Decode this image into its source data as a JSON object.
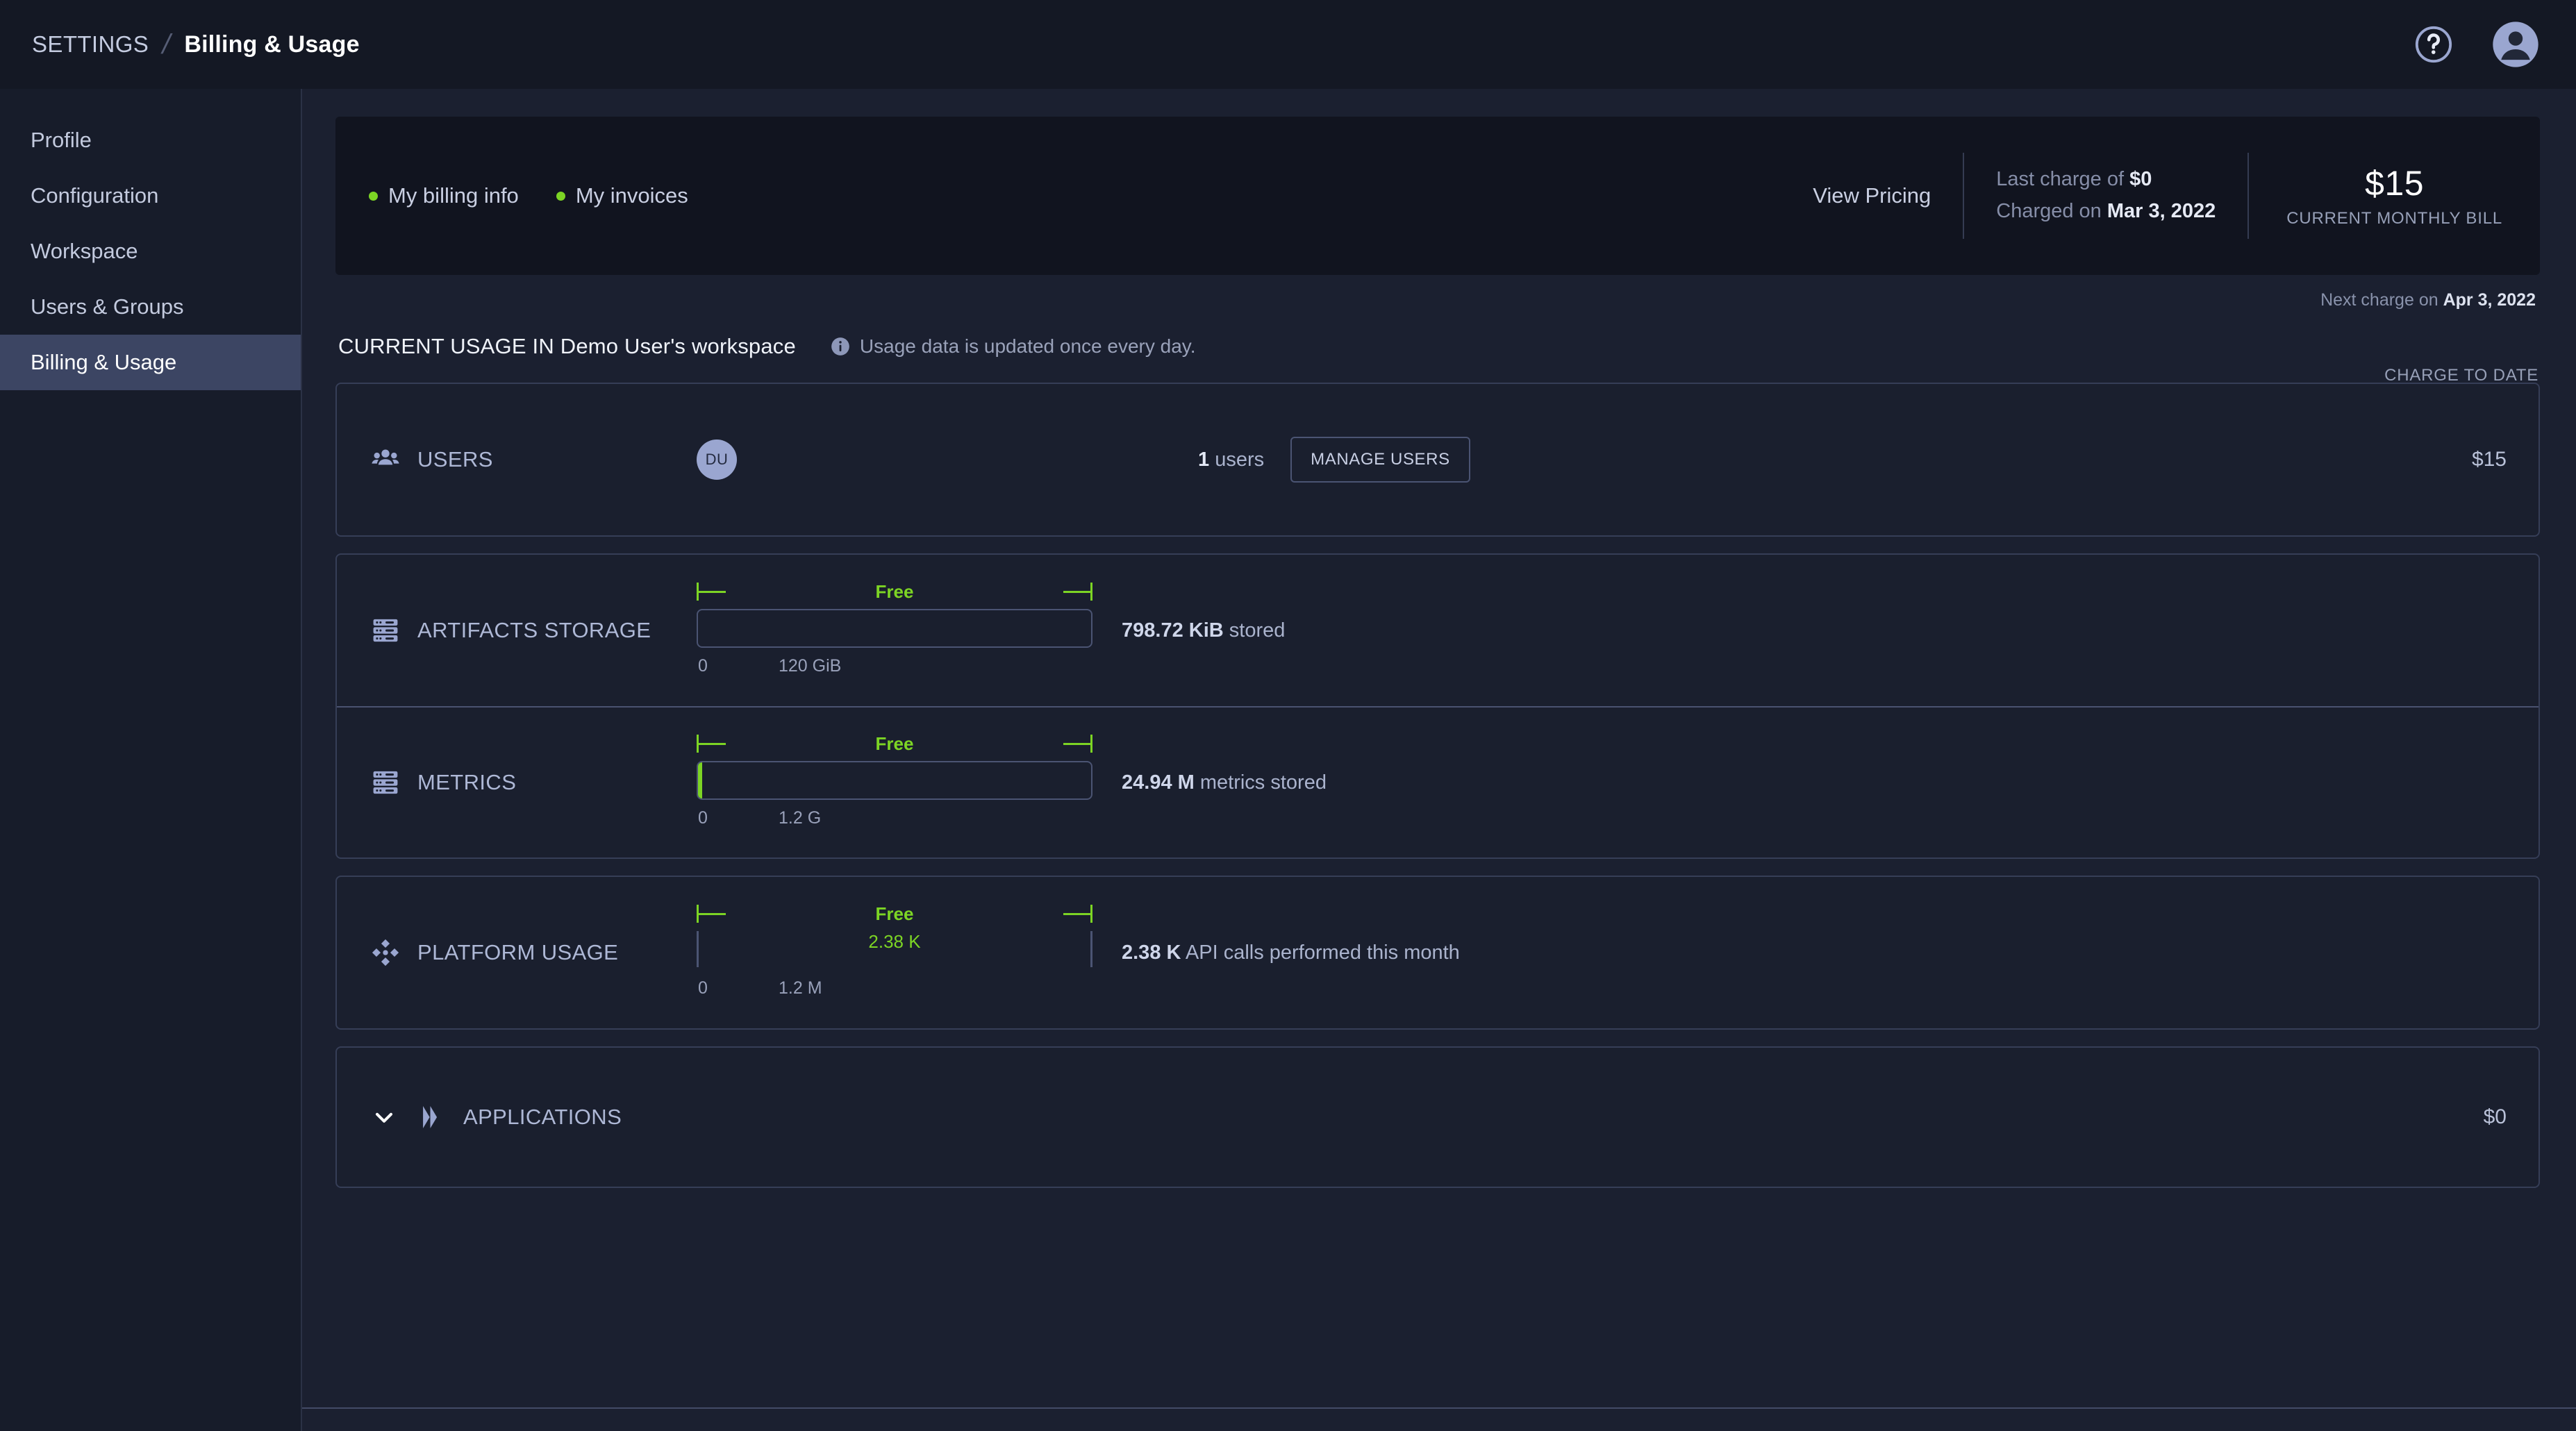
{
  "topbar": {
    "breadcrumb_root": "SETTINGS",
    "breadcrumb_sep": "/",
    "breadcrumb_current": "Billing & Usage",
    "help_icon": "help-circle-icon",
    "avatar_icon": "user-avatar-icon"
  },
  "sidebar": {
    "items": [
      {
        "label": "Profile",
        "active": false
      },
      {
        "label": "Configuration",
        "active": false
      },
      {
        "label": "Workspace",
        "active": false
      },
      {
        "label": "Users & Groups",
        "active": false
      },
      {
        "label": "Billing & Usage",
        "active": true
      }
    ]
  },
  "banner": {
    "links": [
      {
        "label": "My billing info",
        "dot_color": "#7cd424"
      },
      {
        "label": "My invoices",
        "dot_color": "#7cd424"
      }
    ],
    "view_pricing": "View Pricing",
    "last_charge_prefix": "Last charge of ",
    "last_charge_amount": "$0",
    "charged_on_prefix": "Charged on ",
    "charged_on_date": "Mar 3, 2022",
    "current_bill_amount": "$15",
    "current_bill_caption": "CURRENT MONTHLY BILL",
    "next_charge_prefix": "Next charge on ",
    "next_charge_date": "Apr 3, 2022"
  },
  "usage": {
    "title": "CURRENT USAGE IN Demo User's workspace",
    "info_icon": "info-icon",
    "note": "Usage data is updated once every day.",
    "charge_to_date": "CHARGE TO DATE"
  },
  "users_row": {
    "icon": "users-group-icon",
    "label": "USERS",
    "avatar_initials": "DU",
    "count": "1",
    "count_suffix": " users",
    "manage_button": "MANAGE USERS",
    "price": "$15"
  },
  "artifacts_row": {
    "icon": "server-storage-icon",
    "label": "ARTIFACTS STORAGE",
    "free_label": "Free",
    "scale_min": "0",
    "scale_max": "120 GiB",
    "value": "798.72 KiB",
    "value_suffix": " stored",
    "fill_percent": 0
  },
  "metrics_row": {
    "icon": "server-storage-icon",
    "label": "METRICS",
    "free_label": "Free",
    "scale_min": "0",
    "scale_max": "1.2 G",
    "value": "24.94 M",
    "value_suffix": " metrics stored",
    "fill_percent": 2
  },
  "platform_row": {
    "icon": "platform-diamond-icon",
    "label": "PLATFORM USAGE",
    "free_label": "Free",
    "marker_value": "2.38 K",
    "scale_min": "0",
    "scale_max": "1.2 M",
    "value": "2.38 K",
    "value_suffix": " API calls performed this month"
  },
  "applications_row": {
    "chevron_icon": "chevron-down-icon",
    "icon": "applications-double-chevron-icon",
    "label": "APPLICATIONS",
    "price": "$0"
  },
  "colors": {
    "accent_green": "#7cd424",
    "page_bg": "#1b2030",
    "card_bg": "#1a1f2e",
    "sidebar_active": "#3c4563"
  }
}
